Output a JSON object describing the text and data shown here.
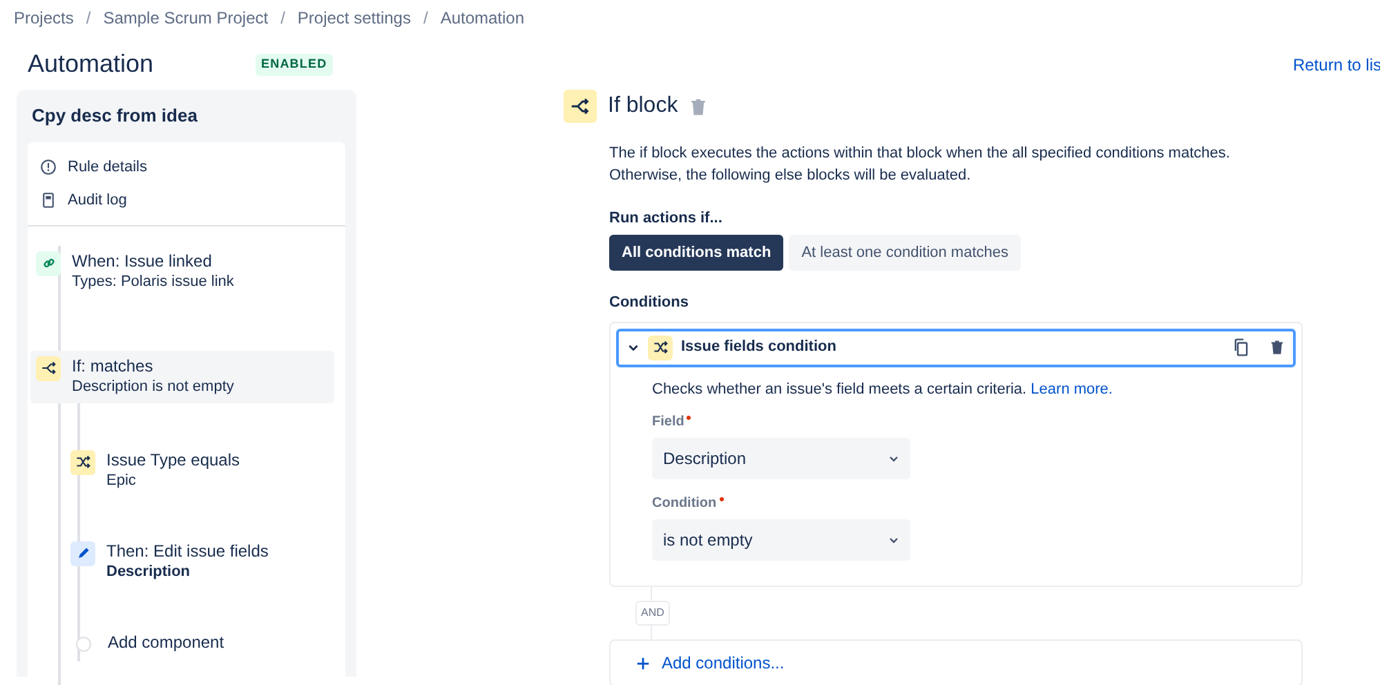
{
  "breadcrumbs": [
    {
      "kind": "link",
      "text": "Projects"
    },
    {
      "kind": "separator",
      "text": "/"
    },
    {
      "kind": "link",
      "text": "Sample Scrum Project"
    },
    {
      "kind": "separator",
      "text": "/"
    },
    {
      "kind": "link",
      "text": "Project settings"
    },
    {
      "kind": "separator",
      "text": "/"
    },
    {
      "kind": "link",
      "text": "Automation"
    }
  ],
  "page_title": "Automation",
  "status_badge": "ENABLED",
  "return_link": "Return to lis",
  "rule": {
    "name": "Cpy desc from idea",
    "menu": [
      {
        "label": "Rule details",
        "kind": "info"
      },
      {
        "label": "Audit log",
        "kind": "log"
      }
    ],
    "steps": [
      {
        "kind": "trigger",
        "title": "When: Issue linked",
        "subtitle": "Types: Polaris issue link",
        "selected": false
      },
      {
        "kind": "if",
        "title": "If: matches",
        "subtitle": "Description is not empty",
        "selected": true,
        "children": [
          {
            "kind": "condition",
            "title": "Issue Type equals",
            "subtitle": "Epic",
            "selected": false
          },
          {
            "kind": "action",
            "title": "Then: Edit issue fields",
            "subtitle": "Description",
            "selected": false
          },
          {
            "kind": "add",
            "title": "Add component",
            "selected": false
          }
        ]
      }
    ]
  },
  "block": {
    "title": "If block",
    "description": "The if block executes the actions within that block when the all specified conditions matches.\nOtherwise, the following else blocks will be evaluated.",
    "run_label": "Run actions if...",
    "run_options": [
      {
        "label": "All conditions match",
        "selected": true
      },
      {
        "label": "At least one condition matches",
        "selected": false
      }
    ],
    "conditions_label": "Conditions",
    "conditions": [
      {
        "title": "Issue fields condition",
        "expanded": true,
        "help": "Checks whether an issue's field meets a certain criteria.",
        "help_link": "Learn more.",
        "fields": [
          {
            "label": "Field",
            "required": true,
            "value": "Description"
          },
          {
            "label": "Condition",
            "required": true,
            "value": "is not empty"
          }
        ]
      }
    ],
    "joiner": "AND",
    "add_button": "Add conditions..."
  }
}
